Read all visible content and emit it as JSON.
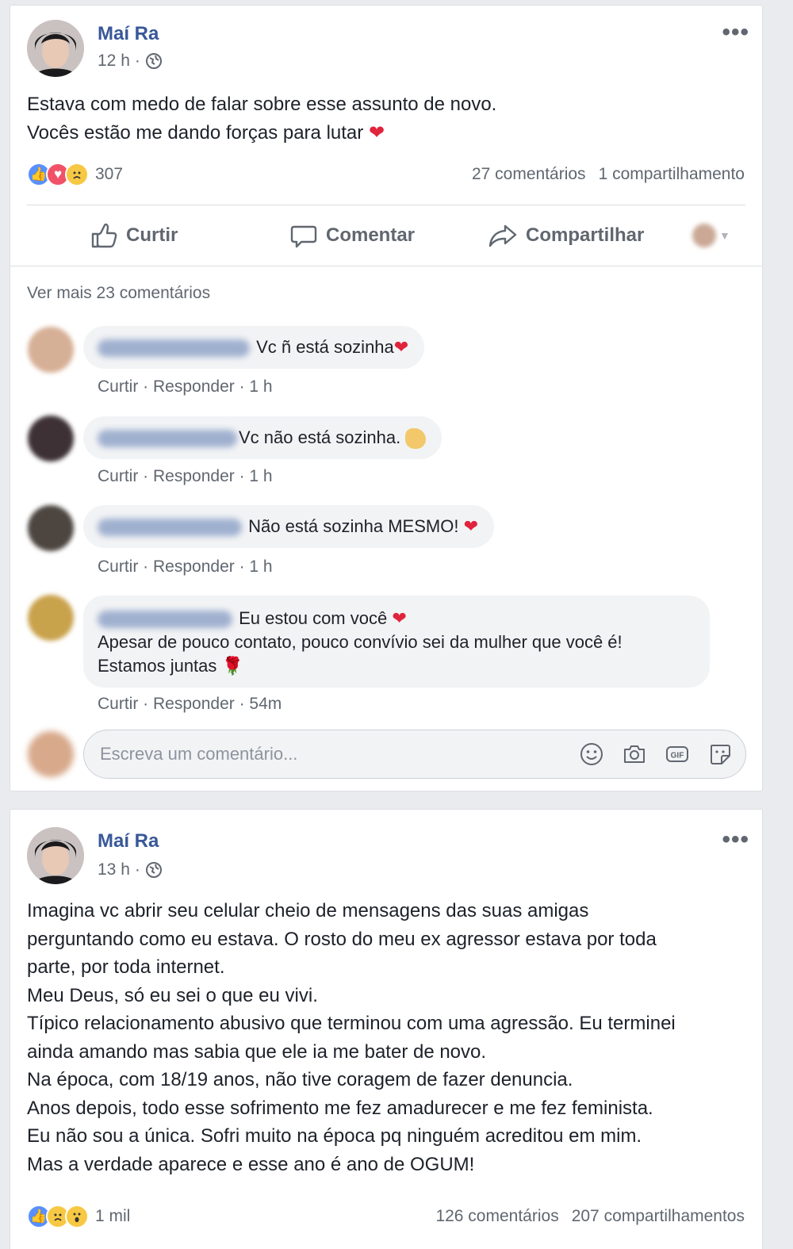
{
  "post1": {
    "author": "Maí Ra",
    "time": "12 h",
    "text": "Estava com medo de falar sobre esse assunto de novo.\nVocês estão me dando forças para lutar",
    "reaction_count": "307",
    "comments_count": "27 comentários",
    "shares_count": "1 compartilhamento",
    "actions": {
      "like": "Curtir",
      "comment": "Comentar",
      "share": "Compartilhar"
    },
    "see_more": "Ver mais 23 comentários",
    "comments": [
      {
        "text": " Vc ñ está sozinha",
        "like": "Curtir",
        "reply": "Responder",
        "time": "1 h"
      },
      {
        "text": "Vc não está sozinha. ",
        "like": "Curtir",
        "reply": "Responder",
        "time": "1 h"
      },
      {
        "text": " Não está sozinha MESMO! ",
        "like": "Curtir",
        "reply": "Responder",
        "time": "1 h"
      },
      {
        "line1": " Eu estou com você ",
        "line2": "Apesar de pouco contato, pouco convívio sei da mulher que você é!",
        "line3": "Estamos juntas ",
        "like": "Curtir",
        "reply": "Responder",
        "time": "54m"
      }
    ],
    "write_placeholder": "Escreva um comentário..."
  },
  "post2": {
    "author": "Maí Ra",
    "time": "13 h",
    "text": "Imagina vc abrir seu celular cheio de mensagens das suas amigas\nperguntando como eu estava. O rosto do meu ex agressor estava por toda\nparte, por toda internet.\nMeu Deus, só eu sei o que eu vivi.\nTípico relacionamento abusivo que terminou com uma agressão. Eu terminei\nainda amando mas sabia que ele ia me bater de novo.\nNa época, com 18/19 anos, não tive coragem de fazer denuncia.\nAnos depois, todo esse sofrimento me fez amadurecer e me fez feminista.\nEu não sou a única. Sofri muito na época pq ninguém acreditou em mim.\nMas a verdade aparece e esse ano é ano de OGUM!",
    "reaction_count": "1 mil",
    "comments_count": "126 comentários",
    "shares_count": "207 compartilhamentos"
  },
  "colors": {
    "link": "#385898",
    "secondary": "#606770",
    "like": "#5890ff",
    "love": "#f25268",
    "heart": "#e0243c"
  }
}
